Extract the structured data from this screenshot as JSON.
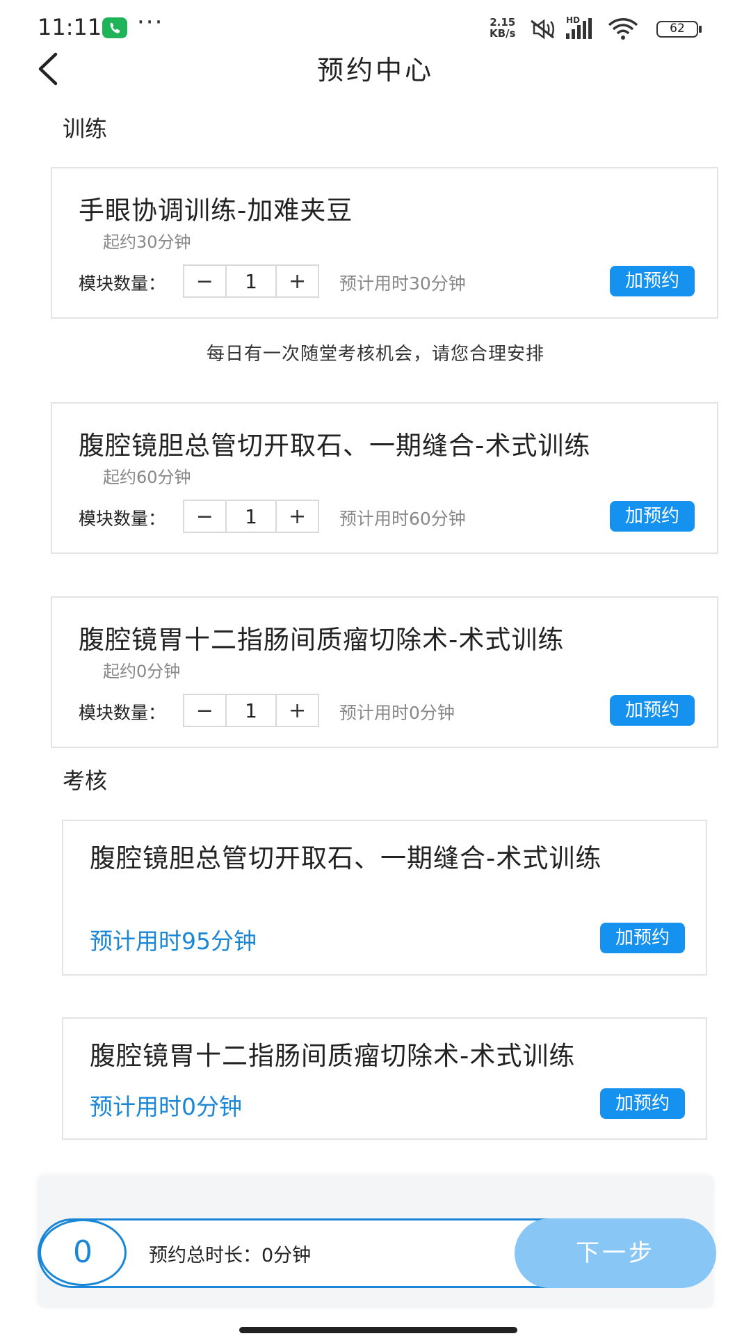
{
  "status_bar": {
    "time": "11:11",
    "more_dots": "···",
    "net_speed_value": "2.15",
    "net_speed_unit": "KB/s",
    "hd_label": "HD",
    "battery": "62"
  },
  "header": {
    "title": "预约中心"
  },
  "training": {
    "section_title": "训练",
    "qty_label": "模块数量：",
    "minus": "−",
    "plus": "+",
    "add_label": "加预约",
    "items": [
      {
        "title": "手眼协调训练-加难夹豆",
        "subtitle": "起约30分钟",
        "qty": "1",
        "estimate": "预计用时30分钟"
      },
      {
        "title": "腹腔镜胆总管切开取石、一期缝合-术式训练",
        "subtitle": "起约60分钟",
        "qty": "1",
        "estimate": "预计用时60分钟"
      },
      {
        "title": "腹腔镜胃十二指肠间质瘤切除术-术式训练",
        "subtitle": "起约0分钟",
        "qty": "1",
        "estimate": "预计用时0分钟"
      }
    ],
    "notice": "每日有一次随堂考核机会，请您合理安排"
  },
  "exam": {
    "section_title": "考核",
    "add_label": "加预约",
    "items": [
      {
        "title": "腹腔镜胆总管切开取石、一期缝合-术式训练",
        "estimate": "预计用时95分钟"
      },
      {
        "title": "腹腔镜胃十二指肠间质瘤切除术-术式训练",
        "estimate": "预计用时0分钟"
      }
    ]
  },
  "footer": {
    "count": "0",
    "total_label": "预约总时长：",
    "total_value": "0分钟",
    "next_label": "下一步"
  },
  "colors": {
    "accent": "#1592f0",
    "accent_text": "#1a86d6",
    "next_disabled": "#87c6f5",
    "call_green": "#1fb35a"
  }
}
